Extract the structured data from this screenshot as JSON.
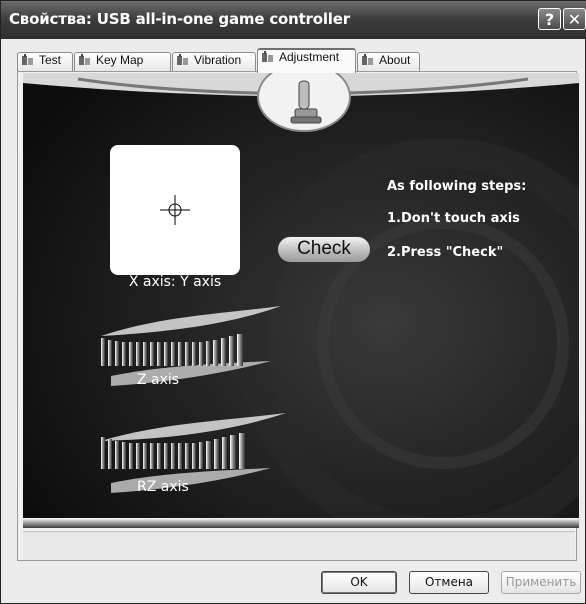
{
  "window": {
    "title": "Свойства: USB all-in-one game controller",
    "help_label": "?",
    "close_label": "✕"
  },
  "tabs": [
    {
      "label": "Test"
    },
    {
      "label": "Key Map"
    },
    {
      "label": "Vibration"
    },
    {
      "label": "Adjustment",
      "active": true
    },
    {
      "label": "About"
    }
  ],
  "adjustment": {
    "xy_label": "X axis: Y axis",
    "check_label": "Check",
    "steps_title": "As following steps:",
    "step1": "1.Don't touch axis",
    "step2": "2.Press \"Check\"",
    "z_label": "Z axis",
    "rz_label": "RZ axis"
  },
  "buttons": {
    "ok": "OK",
    "cancel": "Отмена",
    "apply": "Применить"
  }
}
